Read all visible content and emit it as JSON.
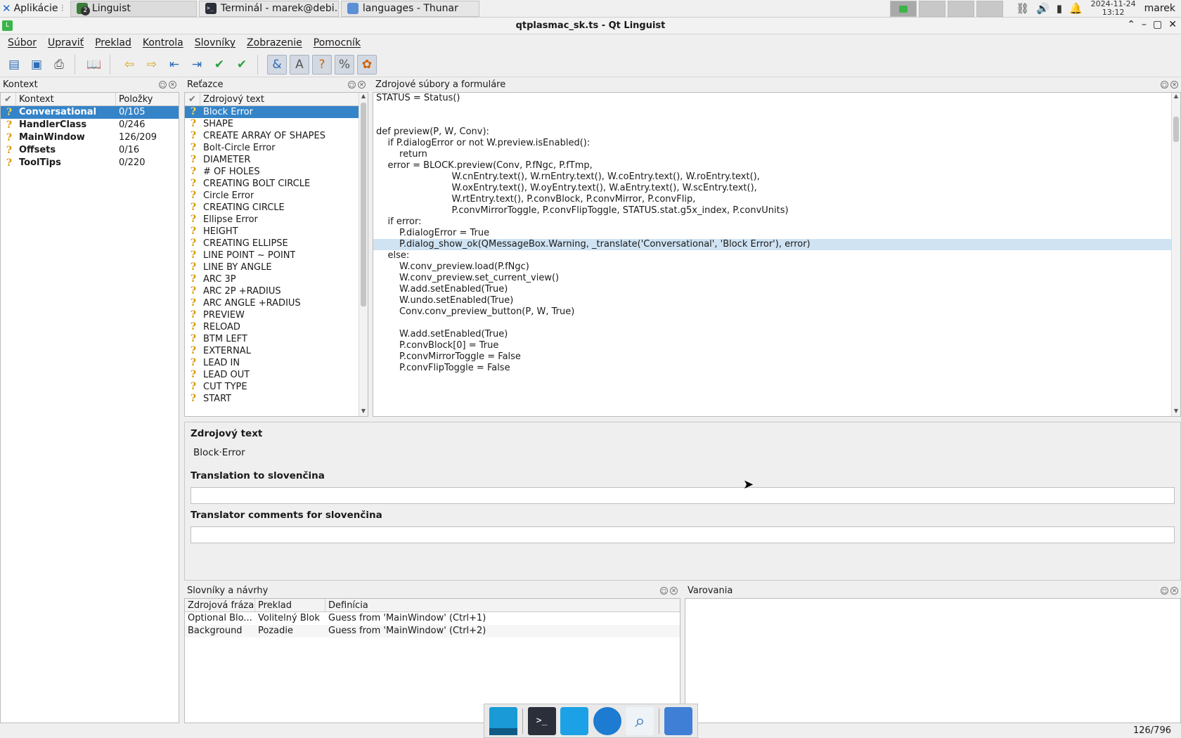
{
  "taskbar": {
    "apps_menu": "Aplikácie",
    "tasks": [
      {
        "label": "Linguist",
        "badge": "2"
      },
      {
        "label": "Terminál - marek@debi..."
      },
      {
        "label": "languages - Thunar"
      }
    ],
    "clock_date": "2024-11-24",
    "clock_time": "13:12",
    "user": "marek"
  },
  "window": {
    "title": "qtplasmac_sk.ts - Qt Linguist",
    "icon_letter": "L"
  },
  "menu": {
    "items": [
      "Súbor",
      "Upraviť",
      "Preklad",
      "Kontrola",
      "Slovníky",
      "Zobrazenie",
      "Pomocník"
    ]
  },
  "toolbar": {
    "icons": [
      "open-icon",
      "save-icon",
      "release-icon",
      "print-icon",
      "phrasebook-icon",
      "prev-unfinished-icon",
      "next-unfinished-icon",
      "prev-icon",
      "next-icon",
      "done-and-next-icon",
      "done-icon",
      "accelerators-check-icon",
      "punctuation-check-icon",
      "phrases-check-icon",
      "placeholders-check-icon",
      "surroundings-check-icon"
    ]
  },
  "context_panel": {
    "title": "Kontext",
    "col_context": "Kontext",
    "col_items": "Položky",
    "rows": [
      {
        "name": "Conversational",
        "items": "0/105"
      },
      {
        "name": "HandlerClass",
        "items": "0/246"
      },
      {
        "name": "MainWindow",
        "items": "126/209"
      },
      {
        "name": "Offsets",
        "items": "0/16"
      },
      {
        "name": "ToolTips",
        "items": "0/220"
      }
    ]
  },
  "strings_panel": {
    "title": "Reťazce",
    "col_source": "Zdrojový text",
    "rows": [
      "Block Error",
      "SHAPE",
      "CREATE ARRAY OF SHAPES",
      "Bolt-Circle Error",
      "DIAMETER",
      "# OF HOLES",
      "CREATING BOLT CIRCLE",
      "Circle Error",
      "CREATING CIRCLE",
      "Ellipse Error",
      "HEIGHT",
      "CREATING ELLIPSE",
      "LINE POINT ~ POINT",
      "LINE BY ANGLE",
      "ARC 3P",
      "ARC 2P +RADIUS",
      "ARC ANGLE +RADIUS",
      "PREVIEW",
      "RELOAD",
      "BTM LEFT",
      "EXTERNAL",
      "LEAD IN",
      "LEAD OUT",
      "CUT TYPE",
      "START"
    ]
  },
  "source_panel": {
    "title": "Zdrojové súbory a formuláre",
    "highlight_index": 13,
    "lines": [
      "STATUS = Status()",
      "",
      "",
      "def preview(P, W, Conv):",
      "    if P.dialogError or not W.preview.isEnabled():",
      "        return",
      "    error = BLOCK.preview(Conv, P.fNgc, P.fTmp,",
      "                          W.cnEntry.text(), W.rnEntry.text(), W.coEntry.text(), W.roEntry.text(),",
      "                          W.oxEntry.text(), W.oyEntry.text(), W.aEntry.text(), W.scEntry.text(),",
      "                          W.rtEntry.text(), P.convBlock, P.convMirror, P.convFlip,",
      "                          P.convMirrorToggle, P.convFlipToggle, STATUS.stat.g5x_index, P.convUnits)",
      "    if error:",
      "        P.dialogError = True",
      "        P.dialog_show_ok(QMessageBox.Warning, _translate('Conversational', 'Block Error'), error)",
      "    else:",
      "        W.conv_preview.load(P.fNgc)",
      "        W.conv_preview.set_current_view()",
      "        W.add.setEnabled(True)",
      "        W.undo.setEnabled(True)",
      "        Conv.conv_preview_button(P, W, True)",
      "",
      "        W.add.setEnabled(True)",
      "        P.convBlock[0] = True",
      "        P.convMirrorToggle = False",
      "        P.convFlipToggle = False"
    ]
  },
  "editor": {
    "source_label": "Zdrojový text",
    "source_text": "Block·Error",
    "translation_label": "Translation to slovenčina",
    "translation_value": "",
    "comments_label": "Translator comments for slovenčina",
    "comments_value": ""
  },
  "phrasebook_panel": {
    "title": "Slovníky a návrhy",
    "col_phrase": "Zdrojová fráza",
    "col_translation": "Preklad",
    "col_definition": "Definícia",
    "rows": [
      {
        "phrase": "Optional Blo...",
        "translation": "Volitelný Blok",
        "definition": "Guess from 'MainWindow' (Ctrl+1)"
      },
      {
        "phrase": "Background",
        "translation": "Pozadie",
        "definition": "Guess from 'MainWindow' (Ctrl+2)"
      }
    ]
  },
  "warnings_panel": {
    "title": "Varovania"
  },
  "status": {
    "counter": "126/796"
  },
  "colors": {
    "selection": "#3584c8",
    "highlight_line": "#cfe3f3",
    "question_mark": "#d99a00"
  }
}
